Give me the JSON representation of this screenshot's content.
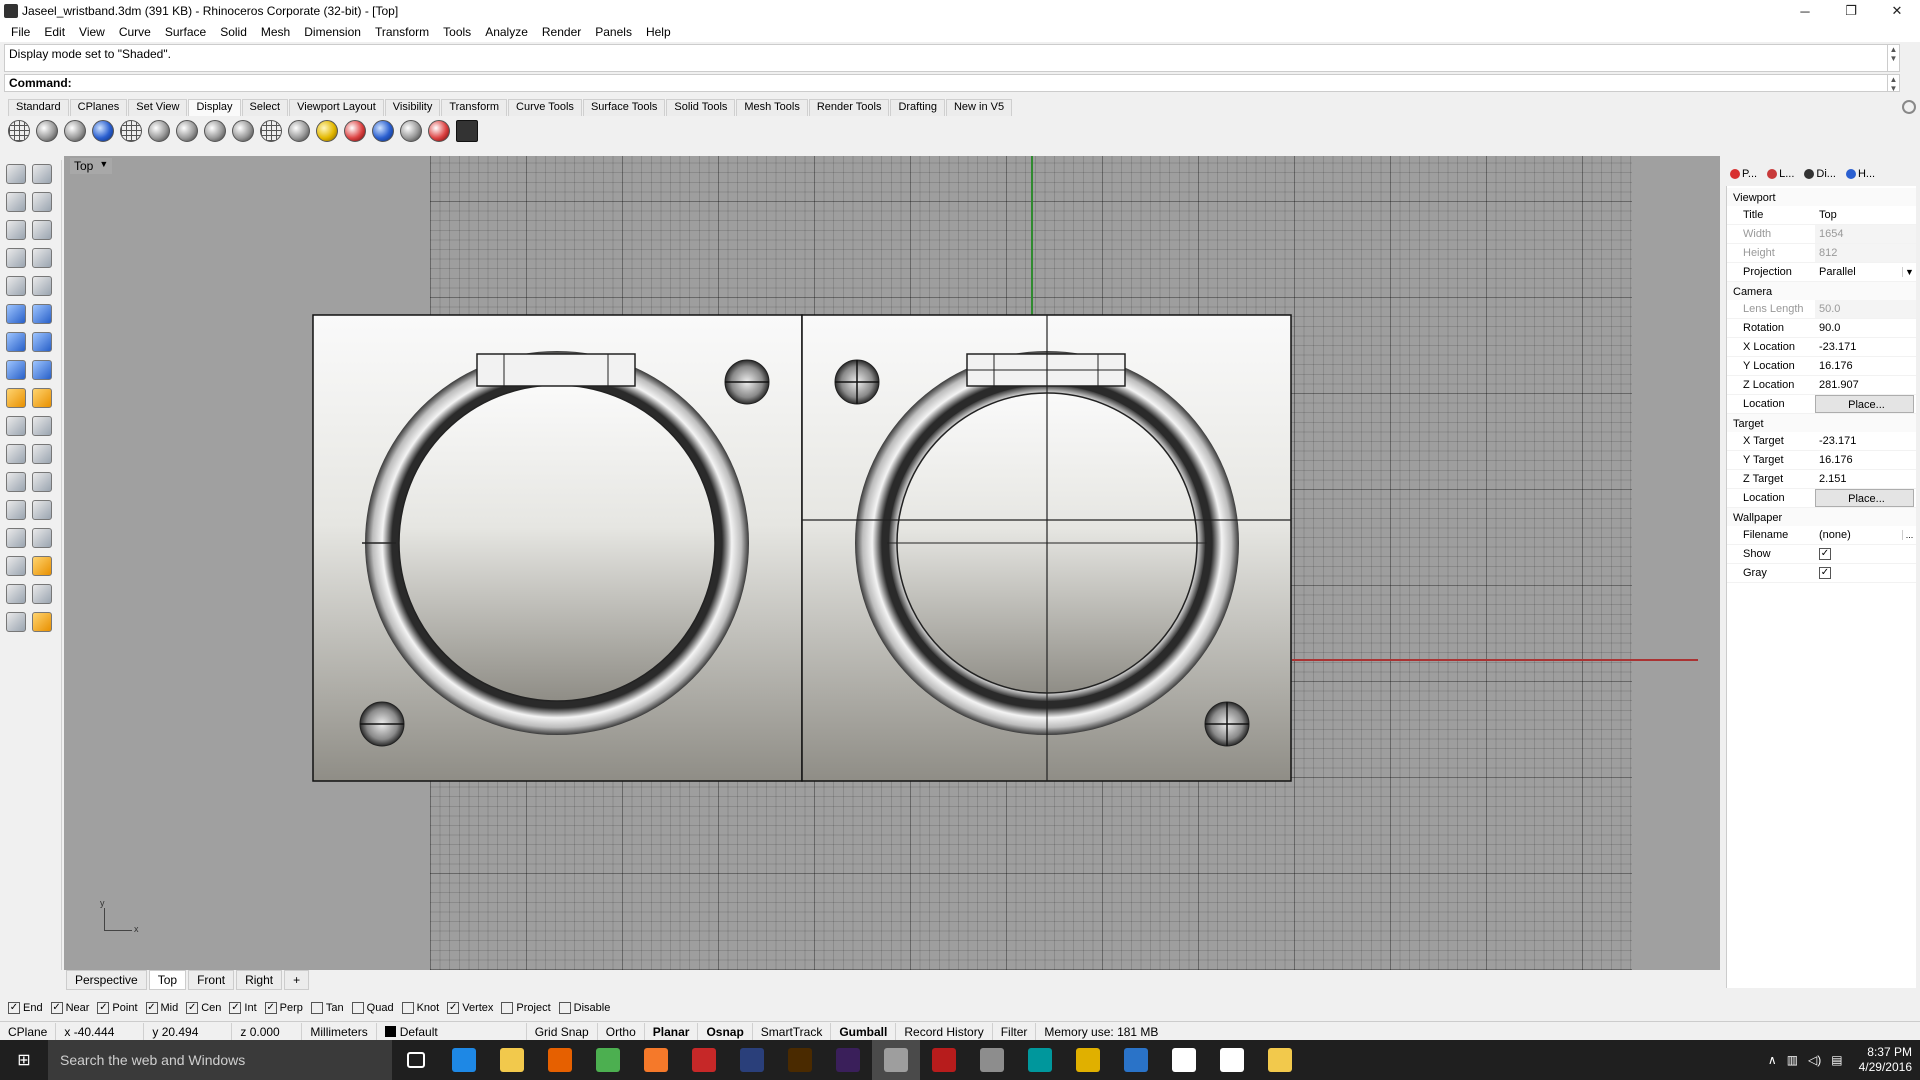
{
  "window": {
    "title": "Jaseel_wristband.3dm (391 KB) - Rhinoceros Corporate (32-bit) - [Top]",
    "minimize": "─",
    "maximize": "❐",
    "close": "✕"
  },
  "menu": [
    "File",
    "Edit",
    "View",
    "Curve",
    "Surface",
    "Solid",
    "Mesh",
    "Dimension",
    "Transform",
    "Tools",
    "Analyze",
    "Render",
    "Panels",
    "Help"
  ],
  "command": {
    "history": "Display mode set to \"Shaded\".",
    "prompt": "Command:"
  },
  "toolbar_tabs": [
    "Standard",
    "CPlanes",
    "Set View",
    "Display",
    "Select",
    "Viewport Layout",
    "Visibility",
    "Transform",
    "Curve Tools",
    "Surface Tools",
    "Solid Tools",
    "Mesh Tools",
    "Render Tools",
    "Drafting",
    "New in V5"
  ],
  "active_toolbar_tab": "Display",
  "viewport": {
    "name": "Top",
    "axis_y": "y",
    "axis_x": "x"
  },
  "viewport_tabs": [
    "Perspective",
    "Top",
    "Front",
    "Right"
  ],
  "viewport_tab_add": "+",
  "active_viewport_tab": "Top",
  "right_panel": {
    "tabs": [
      {
        "label": "P...",
        "icon": "properties-icon",
        "color": "#d83030"
      },
      {
        "label": "L...",
        "icon": "layers-icon",
        "color": "#c83a3a"
      },
      {
        "label": "Di...",
        "icon": "display-icon",
        "color": "#333333"
      },
      {
        "label": "H...",
        "icon": "help-icon",
        "color": "#2a5fd0"
      }
    ],
    "viewport_section": "Viewport",
    "title_label": "Title",
    "title_value": "Top",
    "width_label": "Width",
    "width_value": "1654",
    "height_label": "Height",
    "height_value": "812",
    "projection_label": "Projection",
    "projection_value": "Parallel",
    "camera_section": "Camera",
    "lens_label": "Lens Length",
    "lens_value": "50.0",
    "rotation_label": "Rotation",
    "rotation_value": "90.0",
    "xloc_label": "X Location",
    "xloc_value": "-23.171",
    "yloc_label": "Y Location",
    "yloc_value": "16.176",
    "zloc_label": "Z Location",
    "zloc_value": "281.907",
    "location_label": "Location",
    "place_button": "Place...",
    "target_section": "Target",
    "xtarget_label": "X Target",
    "xtarget_value": "-23.171",
    "ytarget_label": "Y Target",
    "ytarget_value": "16.176",
    "ztarget_label": "Z Target",
    "ztarget_value": "2.151",
    "tlocation_label": "Location",
    "tplace_button": "Place...",
    "wallpaper_section": "Wallpaper",
    "filename_label": "Filename",
    "filename_value": "(none)",
    "filename_button": "...",
    "show_label": "Show",
    "show_checked": true,
    "gray_label": "Gray",
    "gray_checked": true
  },
  "osnaps": [
    {
      "label": "End",
      "checked": true
    },
    {
      "label": "Near",
      "checked": true
    },
    {
      "label": "Point",
      "checked": true
    },
    {
      "label": "Mid",
      "checked": true
    },
    {
      "label": "Cen",
      "checked": true
    },
    {
      "label": "Int",
      "checked": true
    },
    {
      "label": "Perp",
      "checked": true
    },
    {
      "label": "Tan",
      "checked": false
    },
    {
      "label": "Quad",
      "checked": false
    },
    {
      "label": "Knot",
      "checked": false
    },
    {
      "label": "Vertex",
      "checked": true
    },
    {
      "label": "Project",
      "checked": false
    },
    {
      "label": "Disable",
      "checked": false
    }
  ],
  "status": {
    "cplane": "CPlane",
    "x": "x -40.444",
    "y": "y 20.494",
    "z": "z 0.000",
    "units": "Millimeters",
    "layer": "Default",
    "layer_color": "#000000",
    "grid_snap": "Grid Snap",
    "ortho": "Ortho",
    "planar": "Planar",
    "osnap": "Osnap",
    "smarttrack": "SmartTrack",
    "gumball": "Gumball",
    "record_history": "Record History",
    "filter": "Filter",
    "memory": "Memory use: 181 MB"
  },
  "taskbar": {
    "search_placeholder": "Search the web and Windows",
    "apps": [
      {
        "name": "task-view",
        "color": "#ffffff"
      },
      {
        "name": "edge",
        "color": "#1e88e5"
      },
      {
        "name": "file-explorer",
        "color": "#f2c94c"
      },
      {
        "name": "firefox",
        "color": "#e66000"
      },
      {
        "name": "chrome",
        "color": "#4caf50"
      },
      {
        "name": "blender",
        "color": "#f5792a"
      },
      {
        "name": "eagle",
        "color": "#c62828"
      },
      {
        "name": "photoshop",
        "color": "#2a3f7a"
      },
      {
        "name": "illustrator",
        "color": "#4a2a00"
      },
      {
        "name": "premiere",
        "color": "#3a1f5a"
      },
      {
        "name": "rhinoceros",
        "color": "#9e9e9e"
      },
      {
        "name": "app-red",
        "color": "#b71c1c"
      },
      {
        "name": "app-tool",
        "color": "#8d8d8d"
      },
      {
        "name": "arduino",
        "color": "#00979c"
      },
      {
        "name": "app-yellow",
        "color": "#e0b000"
      },
      {
        "name": "visual-studio",
        "color": "#2a73c8"
      },
      {
        "name": "photos",
        "color": "#ffffff"
      },
      {
        "name": "app-settings",
        "color": "#ffffff"
      },
      {
        "name": "app-doc",
        "color": "#f2c94c"
      }
    ],
    "time": "8:37 PM",
    "date": "4/29/2016"
  }
}
